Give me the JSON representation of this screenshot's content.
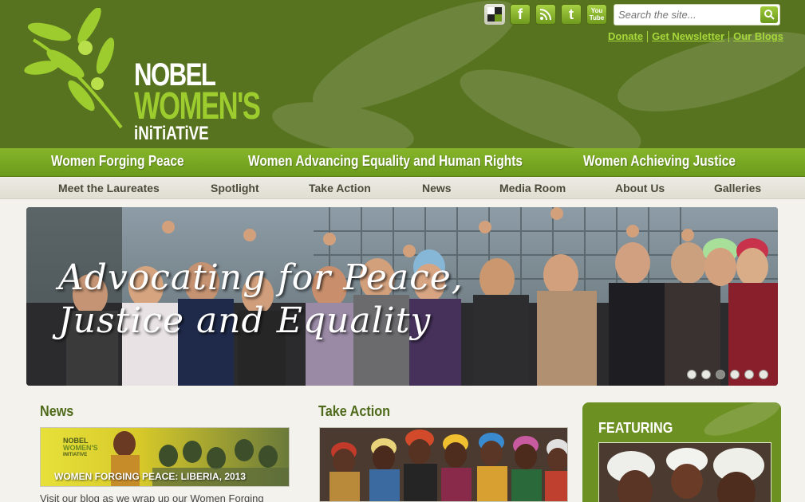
{
  "logo": {
    "line1": "NOBEL",
    "line2": "WOMEN'S",
    "line3": "iNiTiATiVE"
  },
  "social": [
    {
      "icon": "delicious-icon",
      "label": ""
    },
    {
      "icon": "facebook-icon",
      "label": "f"
    },
    {
      "icon": "rss-icon",
      "label": ""
    },
    {
      "icon": "twitter-icon",
      "label": "t"
    },
    {
      "icon": "youtube-icon",
      "label": "You Tube"
    }
  ],
  "search": {
    "placeholder": "Search the site..."
  },
  "toplinks": {
    "donate": "Donate",
    "newsletter": "Get Newsletter",
    "blogs": "Our Blogs"
  },
  "mainnav": {
    "peace": "Women Forging Peace",
    "equality": "Women Advancing Equality and Human Rights",
    "justice": "Women Achieving Justice"
  },
  "subnav": {
    "laureates": "Meet the Laureates",
    "spotlight": "Spotlight",
    "action": "Take Action",
    "news": "News",
    "media": "Media Room",
    "about": "About Us",
    "galleries": "Galleries"
  },
  "banner": {
    "line1": "Advocating for Peace,",
    "line2": "Justice and Equality",
    "slides": 6,
    "active_slide": 3
  },
  "news": {
    "title": "News",
    "image_caption": "WOMEN FORGING PEACE: LIBERIA, 2013",
    "logo_line1": "NOBEL",
    "logo_line2": "WOMEN'S",
    "logo_line3": "INITIATIVE",
    "text": "Visit our blog as we wrap up our Women Forging"
  },
  "take_action": {
    "title": "Take Action"
  },
  "featuring": {
    "title": "FEATURING"
  },
  "colors": {
    "header": "#58731f",
    "accent": "#86b52b",
    "link": "#a7d83b"
  }
}
